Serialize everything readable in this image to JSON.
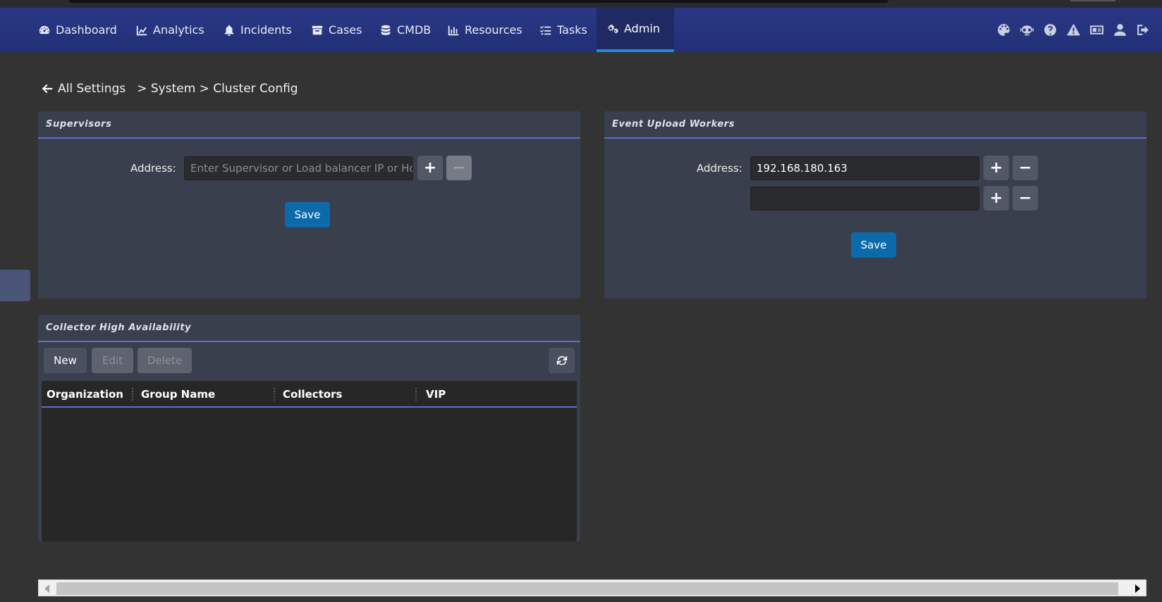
{
  "nav": {
    "items": [
      {
        "label": "Dashboard",
        "icon": "dashboard-icon"
      },
      {
        "label": "Analytics",
        "icon": "chart-icon"
      },
      {
        "label": "Incidents",
        "icon": "bell-icon"
      },
      {
        "label": "Cases",
        "icon": "archive-icon"
      },
      {
        "label": "CMDB",
        "icon": "database-icon"
      },
      {
        "label": "Resources",
        "icon": "bar-chart-icon"
      },
      {
        "label": "Tasks",
        "icon": "tasks-icon"
      },
      {
        "label": "Admin",
        "icon": "gears-icon",
        "active": true
      }
    ],
    "right_icons": [
      "palette-icon",
      "robot-icon",
      "help-icon",
      "warning-icon",
      "id-card-icon",
      "user-icon",
      "logout-icon"
    ],
    "active_color": "#1f8ad6"
  },
  "breadcrumb": {
    "back_label": "All Settings",
    "path": "> System > Cluster Config"
  },
  "supervisors": {
    "title": "Supervisors",
    "address_label": "Address:",
    "address_placeholder": "Enter Supervisor or Load balancer IP or Hos",
    "save_label": "Save"
  },
  "workers": {
    "title": "Event Upload Workers",
    "address_label": "Address:",
    "addresses": [
      "192.168.180.163",
      ""
    ],
    "save_label": "Save"
  },
  "collector_ha": {
    "title": "Collector High Availability",
    "new_label": "New",
    "edit_label": "Edit",
    "delete_label": "Delete",
    "columns": [
      "Organization",
      "Group Name",
      "Collectors",
      "VIP"
    ],
    "rows": []
  },
  "colors": {
    "primary_button": "#0c6aaa",
    "accent_line": "#5a6fc7"
  }
}
